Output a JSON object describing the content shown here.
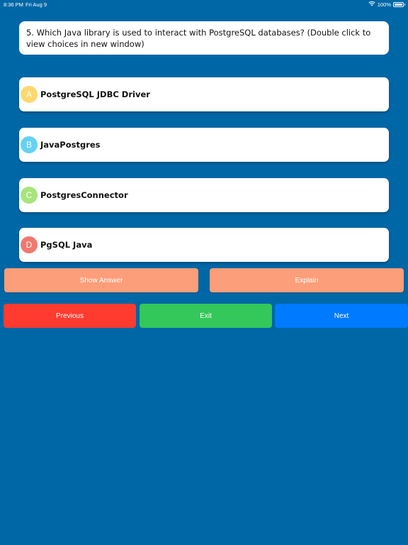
{
  "status_bar": {
    "time": "8:36 PM",
    "date": "Fri Aug 9",
    "battery": "100%",
    "battery_level": 1.0,
    "wifi_icon": "wifi-icon",
    "battery_icon": "battery-icon"
  },
  "question": {
    "text": "5. Which Java library is used to interact with PostgreSQL databases? (Double click to view choices in new window)"
  },
  "choices": [
    {
      "letter": "A",
      "text": "PostgreSQL JDBC Driver",
      "color": "#fdd86f"
    },
    {
      "letter": "B",
      "text": "JavaPostgres",
      "color": "#66d1f2"
    },
    {
      "letter": "C",
      "text": "PostgresConnector",
      "color": "#a6e57c"
    },
    {
      "letter": "D",
      "text": "PgSQL Java",
      "color": "#f2786e"
    }
  ],
  "actions": {
    "show_answer": "Show Answer",
    "explain": "Explain"
  },
  "navigation": {
    "previous": "Previous",
    "exit": "Exit",
    "next": "Next"
  },
  "colors": {
    "background": "#0067a6",
    "action_button": "#fc9e79",
    "previous_button": "#ff3b30",
    "exit_button": "#34c759",
    "next_button": "#007aff"
  }
}
